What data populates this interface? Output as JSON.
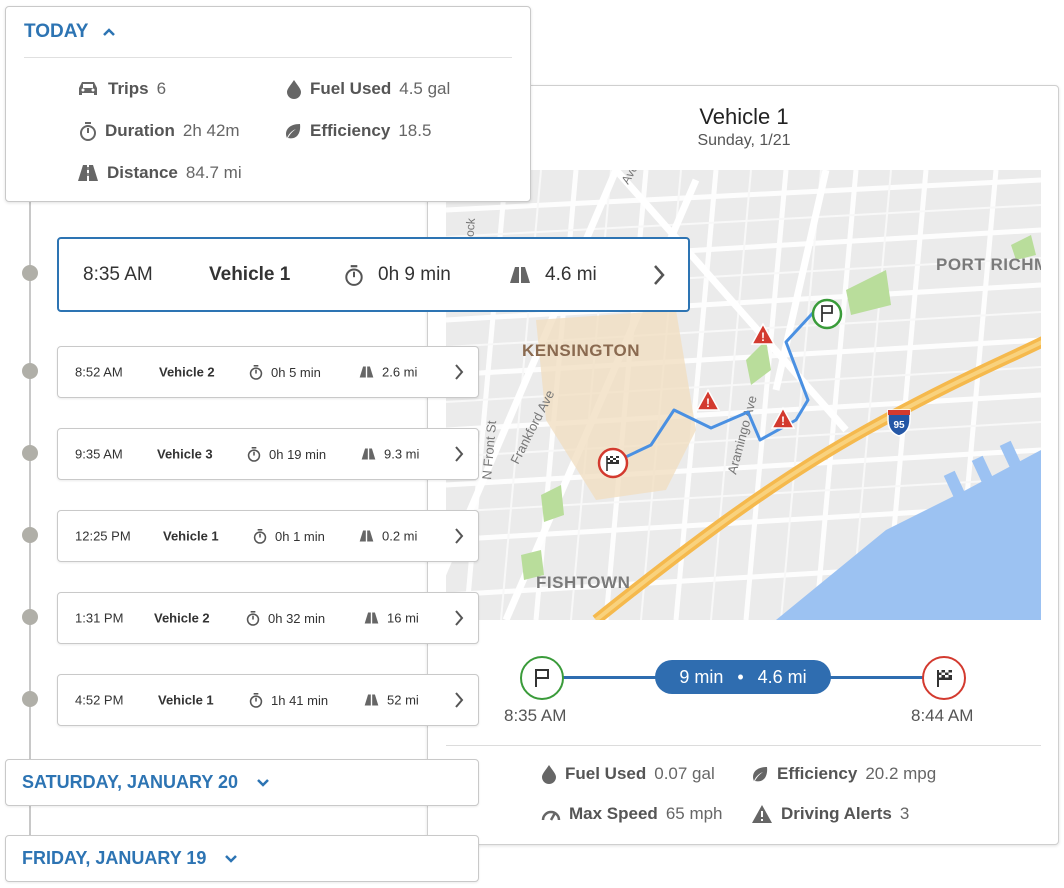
{
  "today": {
    "label": "TODAY",
    "stats": {
      "trips": {
        "label": "Trips",
        "value": "6"
      },
      "duration": {
        "label": "Duration",
        "value": "2h 42m"
      },
      "distance": {
        "label": "Distance",
        "value": "84.7 mi"
      },
      "fuel": {
        "label": "Fuel Used",
        "value": "4.5 gal"
      },
      "efficiency": {
        "label": "Efficiency",
        "value": "18.5"
      }
    }
  },
  "active_trip": {
    "time": "8:35 AM",
    "vehicle": "Vehicle 1",
    "duration": "0h 9 min",
    "distance": "4.6 mi"
  },
  "trips": [
    {
      "time": "8:52 AM",
      "vehicle": "Vehicle 2",
      "duration": "0h 5 min",
      "distance": "2.6 mi"
    },
    {
      "time": "9:35 AM",
      "vehicle": "Vehicle 3",
      "duration": "0h 19 min",
      "distance": "9.3 mi"
    },
    {
      "time": "12:25 PM",
      "vehicle": "Vehicle 1",
      "duration": "0h 1 min",
      "distance": "0.2 mi"
    },
    {
      "time": "1:31 PM",
      "vehicle": "Vehicle 2",
      "duration": "0h 32 min",
      "distance": "16 mi"
    },
    {
      "time": "4:52 PM",
      "vehicle": "Vehicle 1",
      "duration": "1h 41 min",
      "distance": "52 mi"
    }
  ],
  "previous_days": [
    {
      "label": "SATURDAY, JANUARY 20"
    },
    {
      "label": "FRIDAY, JANUARY 19"
    }
  ],
  "detail": {
    "title": "Vehicle 1",
    "date": "Sunday, 1/21",
    "map": {
      "neighborhoods": [
        "KENSINGTON",
        "PORT RICHM",
        "FISHTOWN"
      ],
      "streets": [
        "Frankford Ave",
        "Aramingo Ave",
        "N Front St",
        "Hancock",
        "Ave"
      ],
      "highway_shield": "95"
    },
    "route": {
      "duration": "9 min",
      "separator": "•",
      "distance": "4.6 mi",
      "start_time": "8:35 AM",
      "end_time": "8:44 AM"
    },
    "stats": {
      "fuel": {
        "label": "Fuel Used",
        "value": "0.07 gal"
      },
      "efficiency": {
        "label": "Efficiency",
        "value": "20.2 mpg"
      },
      "max_speed": {
        "label": "Max Speed",
        "value": "65 mph"
      },
      "alerts": {
        "label": "Driving Alerts",
        "value": "3"
      }
    }
  },
  "colors": {
    "accent": "#2d74b3",
    "route": "#2f6db0",
    "start": "#3a9b3a",
    "end": "#d33a2f",
    "alert": "#d33a2f",
    "water": "#9cc2f2",
    "highway": "#f5b94d"
  }
}
